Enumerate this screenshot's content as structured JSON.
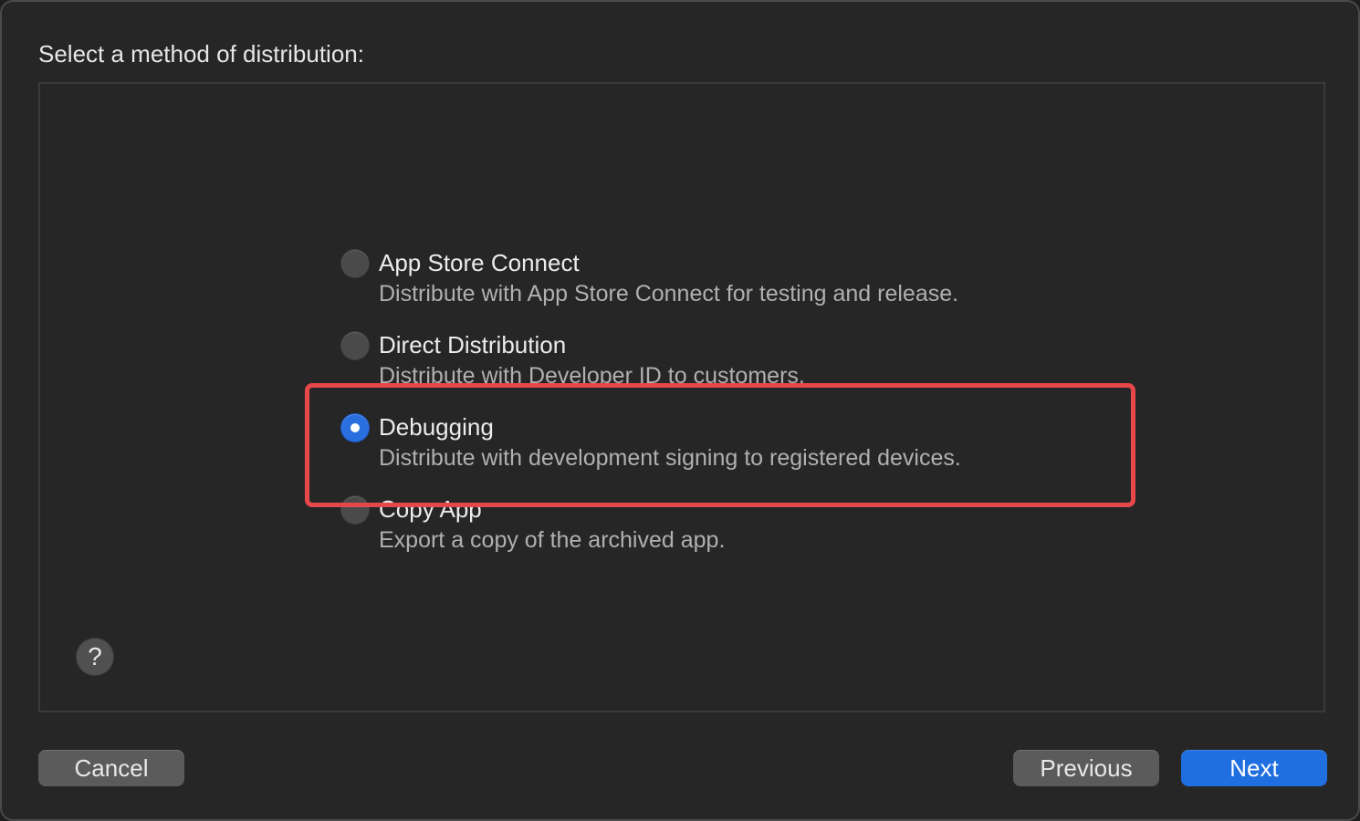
{
  "dialog": {
    "heading": "Select a method of distribution:"
  },
  "options": [
    {
      "title": "App Store Connect",
      "description": "Distribute with App Store Connect for testing and release.",
      "selected": false
    },
    {
      "title": "Direct Distribution",
      "description": "Distribute with Developer ID to customers.",
      "selected": false
    },
    {
      "title": "Debugging",
      "description": "Distribute with development signing to registered devices.",
      "selected": true
    },
    {
      "title": "Copy App",
      "description": "Export a copy of the archived app.",
      "selected": false
    }
  ],
  "help": {
    "label": "?"
  },
  "buttons": {
    "cancel": "Cancel",
    "previous": "Previous",
    "next": "Next"
  },
  "colors": {
    "accent": "#1f6fe0",
    "highlight": "#e8474a"
  },
  "icons": {
    "help": "question-mark-icon"
  }
}
